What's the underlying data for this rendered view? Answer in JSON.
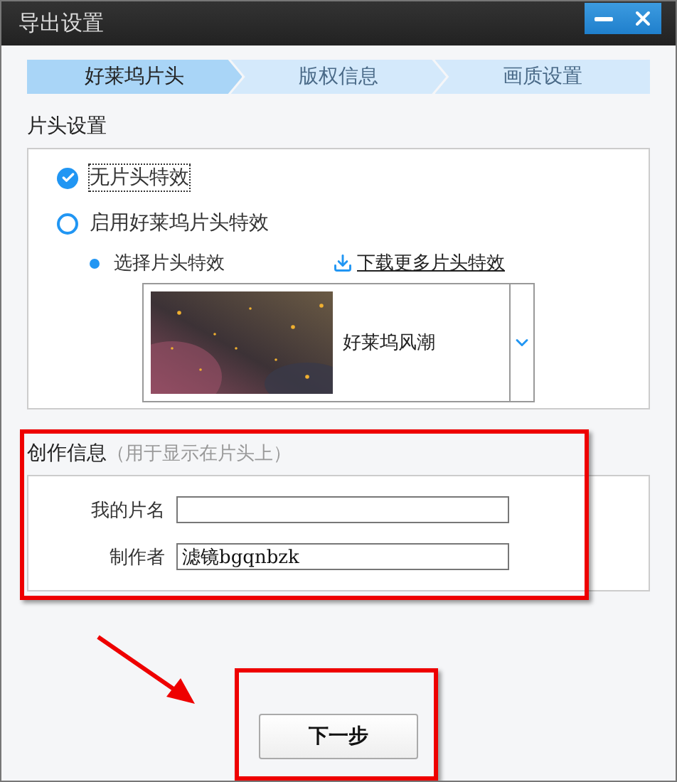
{
  "window": {
    "title": "导出设置"
  },
  "steps": [
    {
      "label": "好莱坞片头",
      "selected": true
    },
    {
      "label": "版权信息",
      "selected": false
    },
    {
      "label": "画质设置",
      "selected": false
    }
  ],
  "intro": {
    "heading": "片头设置",
    "options": [
      {
        "label": "无片头特效",
        "selected": true
      },
      {
        "label": "启用好莱坞片头特效",
        "selected": false
      }
    ],
    "select_label": "选择片头特效",
    "download_link": "下载更多片头特效",
    "effect": {
      "name": "好莱坞风潮"
    }
  },
  "credits": {
    "heading": "创作信息",
    "note": "（用于显示在片头上）",
    "fields": [
      {
        "label": "我的片名"
      },
      {
        "label": "制作者",
        "value": "滤镜bgqnbzk"
      }
    ]
  },
  "buttons": [
    "下一步"
  ]
}
